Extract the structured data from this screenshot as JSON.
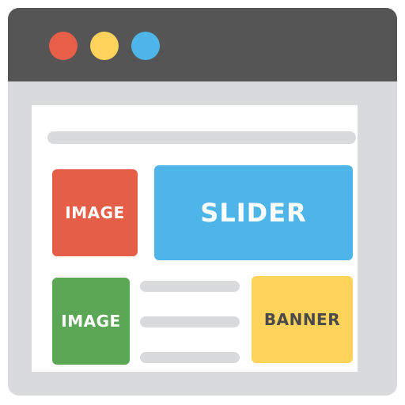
{
  "window": {
    "titlebar_color": "#555555",
    "controls": [
      {
        "name": "close",
        "color": "#e75f48"
      },
      {
        "name": "minimize",
        "color": "#fdd35b"
      },
      {
        "name": "maximize",
        "color": "#4db5e8"
      }
    ]
  },
  "content": {
    "blocks": {
      "image_top": {
        "label": "IMAGE",
        "color": "#e55f48"
      },
      "slider": {
        "label": "SLIDER",
        "color": "#4db5e8"
      },
      "image_bottom": {
        "label": "IMAGE",
        "color": "#5ca755"
      },
      "banner": {
        "label": "BANNER",
        "color": "#fdd35b"
      }
    }
  }
}
